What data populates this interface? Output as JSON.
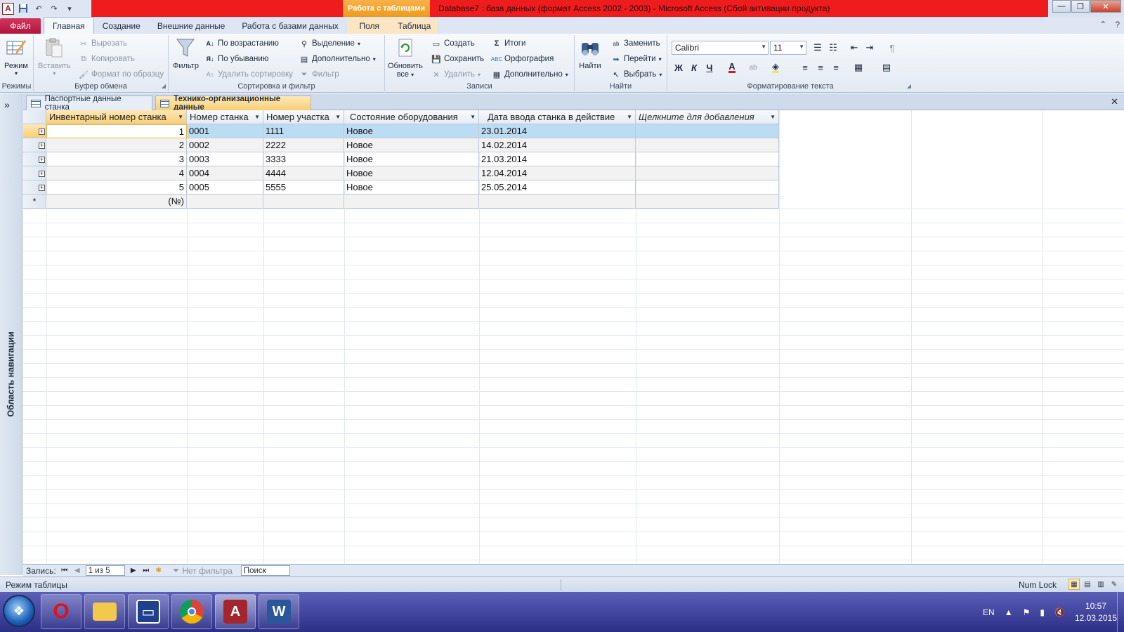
{
  "titlebar": {
    "app_letter": "A",
    "context_tab_group": "Работа с таблицами",
    "title": "Database7 : база данных (формат Access 2002 - 2003)  -  Microsoft Access (Сбой активации продукта)"
  },
  "ribbon_tabs": [
    "Файл",
    "Главная",
    "Создание",
    "Внешние данные",
    "Работа с базами данных",
    "Поля",
    "Таблица"
  ],
  "ribbon": {
    "views": {
      "mode": "Режим",
      "label": "Режимы"
    },
    "clipboard": {
      "paste": "Вставить",
      "cut": "Вырезать",
      "copy": "Копировать",
      "format_painter": "Формат по образцу",
      "label": "Буфер обмена"
    },
    "sort_filter": {
      "filter": "Фильтр",
      "asc": "По возрастанию",
      "desc": "По убыванию",
      "remove_sort": "Удалить сортировку",
      "selection": "Выделение",
      "advanced": "Дополнительно",
      "toggle_filter": "Фильтр",
      "label": "Сортировка и фильтр"
    },
    "records": {
      "refresh": "Обновить",
      "refresh2": "все",
      "new": "Создать",
      "save": "Сохранить",
      "delete": "Удалить",
      "totals": "Итоги",
      "spelling": "Орфография",
      "more": "Дополнительно",
      "label": "Записи"
    },
    "find": {
      "find": "Найти",
      "replace": "Заменить",
      "goto": "Перейти",
      "select": "Выбрать",
      "label": "Найти"
    },
    "text_format": {
      "font": "Calibri",
      "size": "11",
      "bold": "Ж",
      "italic": "К",
      "underline": "Ч",
      "label": "Форматирование текста"
    }
  },
  "nav_pane": {
    "label": "Область навигации",
    "toggle": "»"
  },
  "doc_tabs": [
    "Паспортные данные станка",
    "Технико-организационные данные"
  ],
  "table": {
    "columns": [
      "Инвентарный номер станка",
      "Номер станка",
      "Номер участка",
      "Состояние оборудования",
      "Дата ввода станка в действие",
      "Щелкните для добавления"
    ],
    "rows": [
      [
        "1",
        "0001",
        "1111",
        "Новое",
        "23.01.2014"
      ],
      [
        "2",
        "0002",
        "2222",
        "Новое",
        "14.02.2014"
      ],
      [
        "3",
        "0003",
        "3333",
        "Новое",
        "21.03.2014"
      ],
      [
        "4",
        "0004",
        "4444",
        "Новое",
        "12.04.2014"
      ],
      [
        "5",
        "0005",
        "5555",
        "Новое",
        "25.05.2014"
      ]
    ],
    "new_row_marker": "*",
    "new_row_value": "(№)"
  },
  "record_nav": {
    "label": "Запись:",
    "position": "1 из 5",
    "filter": "Нет фильтра",
    "search": "Поиск"
  },
  "status": {
    "mode": "Режим таблицы",
    "numlock": "Num Lock"
  },
  "taskbar": {
    "lang": "EN",
    "time": "10:57",
    "date": "12.03.2015"
  }
}
